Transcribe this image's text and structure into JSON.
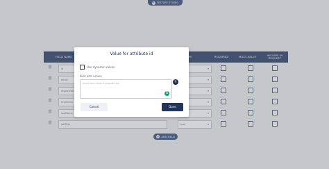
{
  "top_button": {
    "label": "FEATURE STUDIO"
  },
  "table": {
    "headers": {
      "field_name": "FIELD NAME",
      "type": "TYPE",
      "required": "REQUIRED",
      "multi_value": "MULTI-VALUE",
      "include_in_request": "INCLUDE IN REQUEST"
    },
    "rows": [
      {
        "name": "id",
        "type": ""
      },
      {
        "name": "email",
        "type": ""
      },
      {
        "name": "displayName",
        "type": ""
      },
      {
        "name": "firstName",
        "type": ""
      },
      {
        "name": "lastName",
        "type": ""
      }
    ],
    "last_row": {
      "name": "jobTitle",
      "type": "text"
    }
  },
  "add_field": {
    "label": "ADD FIELD"
  },
  "modal": {
    "title": "Value for attribute id",
    "use_dynamic_values": "Use dynamic values",
    "bulk_add_label": "Bulk add values",
    "bulk_placeholder": "Insert each value in separate line",
    "cancel_label": "Cancel",
    "done_label": "Done"
  },
  "colors": {
    "header_bg": "#42526e",
    "primary": "#21365a",
    "overlay": "#c6c7cb",
    "grammarly_green": "#16a06b"
  }
}
